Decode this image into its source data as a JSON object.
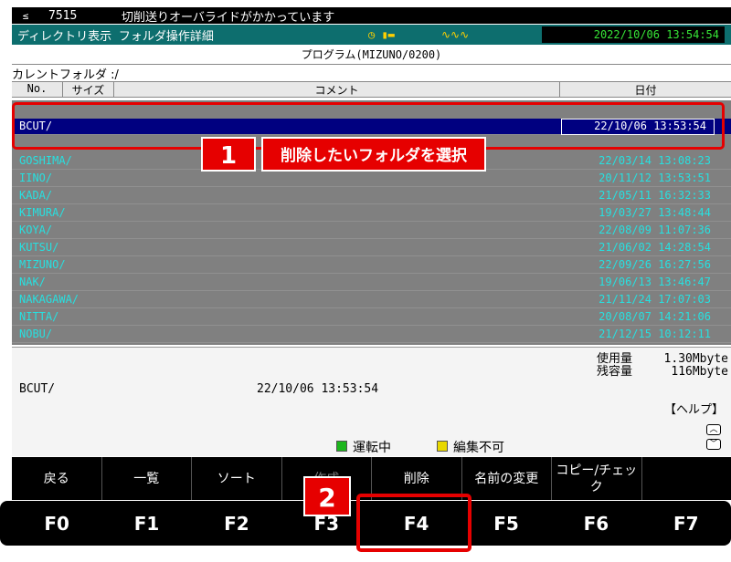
{
  "topbar": {
    "logo": "≤",
    "number": "7515",
    "message": "切削送りオーバライドがかかっています"
  },
  "statusbar": {
    "mode": "ディレクトリ表示 フォルダ操作詳細",
    "icon1": "clock-icon",
    "icon2": "wave-icon",
    "datetime": "2022/10/06 13:54:54"
  },
  "program_line": "プログラム(MIZUNO/0200)",
  "current_folder": "カレントフォルダ :/",
  "columns": {
    "no": "No.",
    "size": "サイズ",
    "comment": "コメント",
    "date": "日付"
  },
  "rows": [
    {
      "name": "BCUT/",
      "date": "22/10/06 13:53:54"
    },
    {
      "name": "GOSHIMA/",
      "date": "22/03/14 13:08:23"
    },
    {
      "name": "IINO/",
      "date": "20/11/12 13:53:51"
    },
    {
      "name": "KADA/",
      "date": "21/05/11 16:32:33"
    },
    {
      "name": "KIMURA/",
      "date": "19/03/27 13:48:44"
    },
    {
      "name": "KOYA/",
      "date": "22/08/09 11:07:36"
    },
    {
      "name": "KUTSU/",
      "date": "21/06/02 14:28:54"
    },
    {
      "name": "MIZUNO/",
      "date": "22/09/26 16:27:56"
    },
    {
      "name": "NAK/",
      "date": "19/06/13 13:46:47"
    },
    {
      "name": "NAKAGAWA/",
      "date": "21/11/24 17:07:03"
    },
    {
      "name": "NITTA/",
      "date": "20/08/07 14:21:06"
    },
    {
      "name": "NOBU/",
      "date": "21/12/15 10:12:11"
    }
  ],
  "callout1": {
    "number": "1",
    "text": "削除したいフォルダを選択"
  },
  "info": {
    "used_label": "使用量",
    "used_value": "1.30Mbyte",
    "free_label": "残容量",
    "free_value": "116Mbyte",
    "selected_name": "BCUT/",
    "selected_date": "22/10/06   13:53:54",
    "help": "【ヘルプ】",
    "legend_running": "運転中",
    "legend_locked": "編集不可",
    "color_running": "#1db61d",
    "color_locked": "#e8d800"
  },
  "functions": [
    "戻る",
    "一覧",
    "ソート",
    "作成",
    "削除",
    "名前の変更",
    "コピー/チェック",
    ""
  ],
  "keys": [
    "F0",
    "F1",
    "F2",
    "F3",
    "F4",
    "F5",
    "F6",
    "F7"
  ],
  "callout2": {
    "number": "2"
  }
}
